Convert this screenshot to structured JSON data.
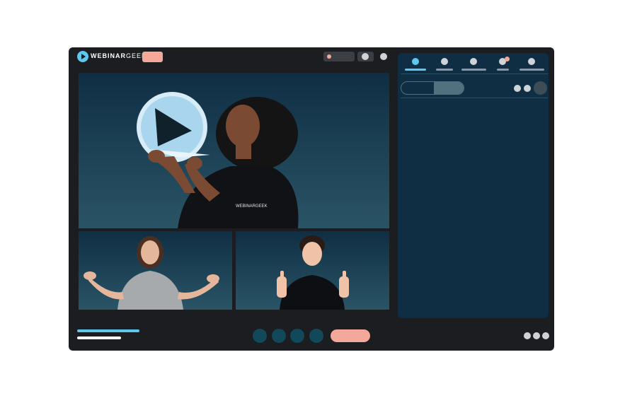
{
  "app": {
    "brand_bold": "WEBINAR",
    "brand_light": "GEEK"
  },
  "main_video": {
    "shirt_text": "WEBINARGEEK"
  },
  "colors": {
    "accent": "#5fc6ee",
    "highlight": "#f4a89a",
    "frame": "#1b1d20",
    "panel": "#0f2e44"
  }
}
